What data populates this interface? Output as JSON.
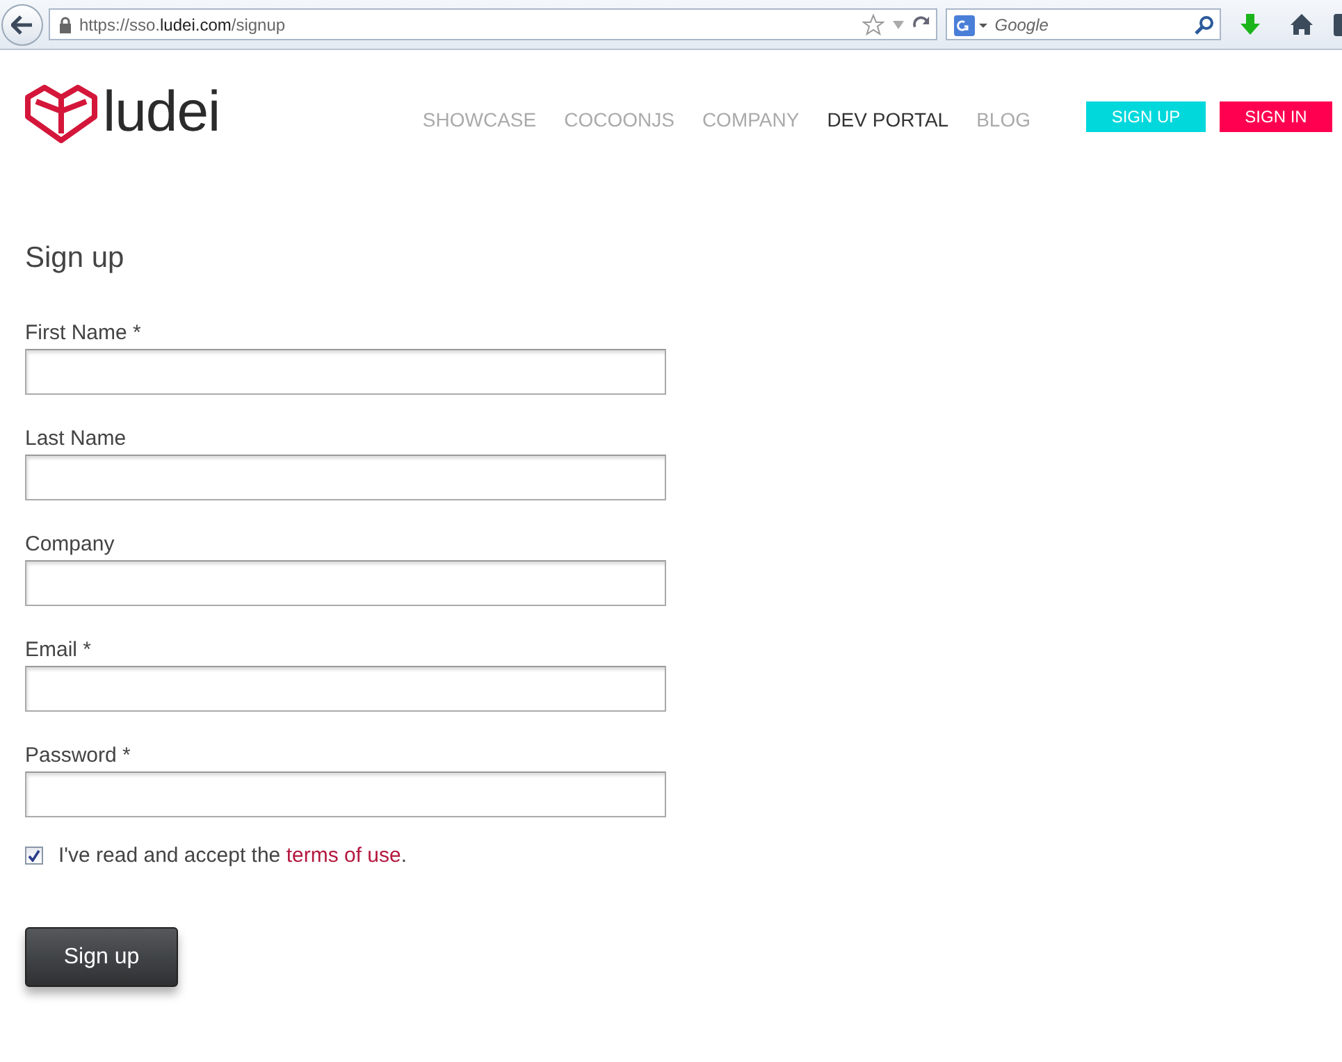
{
  "browser": {
    "url": "https://sso.**ludei.com**/signup",
    "search_placeholder": "Google"
  },
  "header": {
    "logo": "ludei",
    "nav": [
      {
        "label": "SHOWCASE",
        "selected": false
      },
      {
        "label": "COCOONJS",
        "selected": false
      },
      {
        "label": "COMPANY",
        "selected": false
      },
      {
        "label": "DEV PORTAL",
        "selected": true
      },
      {
        "label": "BLOG",
        "selected": false
      }
    ],
    "buttons": [
      {
        "label": "SIGN UP",
        "kind": "signup"
      },
      {
        "label": "SIGN IN",
        "kind": "signin"
      }
    ]
  },
  "form": {
    "title": "Sign up",
    "fields": [
      {
        "label": "First Name *"
      },
      {
        "label": "Last Name"
      },
      {
        "label": "Company"
      },
      {
        "label": "Email *"
      },
      {
        "label": "Password *"
      }
    ],
    "consent": {
      "checked": true,
      "text": "I've read and accept the ",
      "link": "terms of use",
      "after": "."
    },
    "submit": "Sign up"
  }
}
